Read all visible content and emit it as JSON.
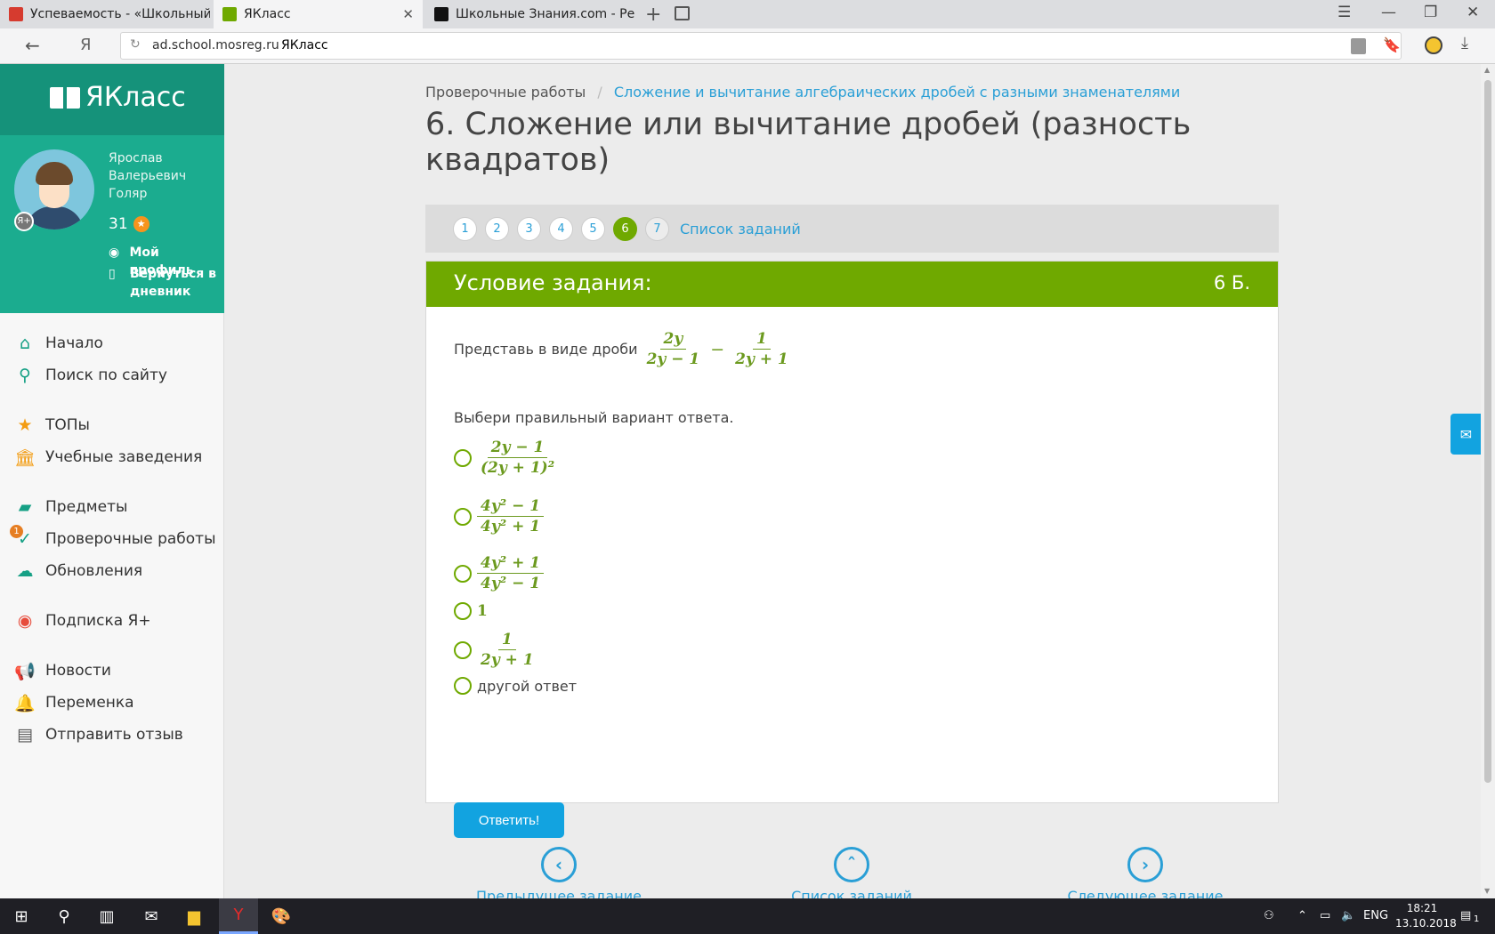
{
  "browser": {
    "tabs": [
      {
        "label": "Успеваемость - «Школьный по",
        "favicon_color": "#d63b2f"
      },
      {
        "label": "ЯКласс",
        "favicon_color": "#6fa900"
      },
      {
        "label": "Школьные Знания.com - Реша",
        "favicon_color": "#111111"
      }
    ],
    "url_host": "ad.school.mosreg.ru",
    "page_title": "ЯКласс"
  },
  "sidebar": {
    "logo": "ЯКласс",
    "user_name": "Ярослав Валерьевич Голяр",
    "points": "31",
    "my_profile": "Мой профиль",
    "back_to_diary": "Вернуться в дневник",
    "nav_groups": [
      [
        {
          "label": "Начало",
          "icon": "home-icon"
        },
        {
          "label": "Поиск по сайту",
          "icon": "search-icon"
        }
      ],
      [
        {
          "label": "ТОПы",
          "icon": "star-icon"
        },
        {
          "label": "Учебные заведения",
          "icon": "school-icon"
        }
      ],
      [
        {
          "label": "Предметы",
          "icon": "books-icon"
        },
        {
          "label": "Проверочные работы",
          "icon": "check-icon",
          "badge": "1"
        },
        {
          "label": "Обновления",
          "icon": "cloud-icon"
        }
      ],
      [
        {
          "label": "Подписка Я+",
          "icon": "yaplus-icon"
        }
      ],
      [
        {
          "label": "Новости",
          "icon": "megaphone-icon"
        },
        {
          "label": "Переменка",
          "icon": "bell-icon"
        },
        {
          "label": "Отправить отзыв",
          "icon": "feedback-icon"
        }
      ]
    ]
  },
  "breadcrumb": {
    "root": "Проверочные работы",
    "current": "Сложение и вычитание алгебраических дробей с разными знаменателями"
  },
  "title": "6. Сложение или вычитание дробей (разность квадратов)",
  "steps": [
    "1",
    "2",
    "3",
    "4",
    "5",
    "6",
    "7"
  ],
  "active_step": "6",
  "task_list_link": "Список заданий",
  "task": {
    "header": "Условие задания:",
    "points": "6 Б.",
    "prompt": "Представь в виде дроби",
    "expression": {
      "frac1": {
        "num": "2y",
        "den": "2y − 1"
      },
      "operator": "−",
      "frac2": {
        "num": "1",
        "den": "2y + 1"
      }
    },
    "instruction": "Выбери правильный вариант ответа.",
    "options": [
      {
        "num": "2y − 1",
        "den": "(2y + 1)²"
      },
      {
        "num": "4y² − 1",
        "den": "4y² + 1"
      },
      {
        "num": "4y² + 1",
        "den": "4y² − 1"
      },
      {
        "text": "1"
      },
      {
        "num": "1",
        "den": "2y + 1"
      },
      {
        "text": "другой ответ"
      }
    ],
    "submit": "Ответить!"
  },
  "bottom_nav": {
    "prev": "Предыдущее задание",
    "list": "Список заданий",
    "next": "Следующее задание"
  },
  "taskbar": {
    "lang": "ENG",
    "time": "18:21",
    "date": "13.10.2018",
    "notifications": "1"
  },
  "colors": {
    "brand_green": "#6fa900",
    "sidebar_teal": "#1bac8f",
    "link_blue": "#2a9fd6",
    "button_blue": "#12a3e0"
  }
}
